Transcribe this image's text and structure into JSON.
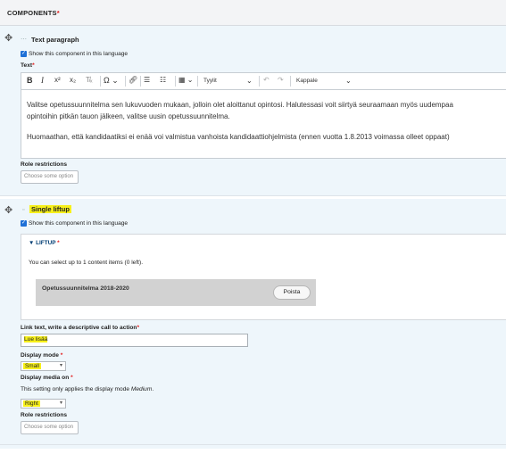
{
  "header": {
    "title": "COMPONENTS",
    "required_mark": "*"
  },
  "component1": {
    "type": "Text paragraph",
    "show_label": "Show this component in this language",
    "text_label": "Text",
    "required_mark": "*",
    "toolbar": {
      "styles": "Tyylit",
      "format": "Kappale"
    },
    "editor": {
      "line1": "Valitse opetussuunnitelma sen lukuvuoden mukaan, jolloin olet aloittanut opintosi. Halutessasi voit siirtyä seuraamaan myös uudempaa",
      "line2": "opintoihin pitkän tauon jälkeen, valitse uusin opetussuunnitelma.",
      "line3": "Huomaathan, että kandidaatiksi ei enää voi valmistua vanhoista kandidaattiohjelmista (ennen vuotta 1.8.2013 voimassa olleet oppaat)"
    },
    "role_label": "Role restrictions",
    "role_placeholder": "Choose some option"
  },
  "component2": {
    "type": "Single liftup",
    "show_label": "Show this component in this language",
    "liftup": {
      "label": "LIFTUP",
      "required_mark": "*",
      "info": "You can select up to 1 content items (0 left).",
      "item_title": "Opetussuunnitelma 2018-2020",
      "remove_label": "Poista"
    },
    "link_text_label": "Link text, write a descriptive call to action",
    "link_text_value": "Lue lisää",
    "display_mode_label": "Display mode",
    "display_mode_value": "Small",
    "media_label": "Display media on",
    "media_note_prefix": "This setting only applies the display mode ",
    "media_note_mode": "Medium",
    "media_note_suffix": ".",
    "media_value": "Right",
    "role_label": "Role restrictions",
    "role_placeholder": "Choose some option",
    "required_mark": "*"
  },
  "colors": {
    "highlight": "#f7f01a",
    "accent": "#1d6fd6",
    "required": "#e21a1a"
  }
}
